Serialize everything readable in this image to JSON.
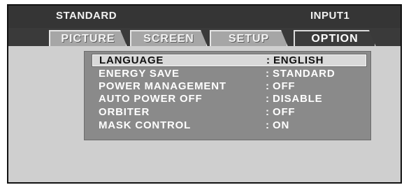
{
  "status": {
    "mode": "STANDARD",
    "input": "INPUT1"
  },
  "tabs": [
    {
      "label": "PICTURE",
      "active": false
    },
    {
      "label": "SCREEN",
      "active": false
    },
    {
      "label": "SETUP",
      "active": false
    },
    {
      "label": "OPTION",
      "active": true
    }
  ],
  "menu": {
    "separator": ":",
    "items": [
      {
        "label": "LANGUAGE",
        "value": "ENGLISH",
        "selected": true
      },
      {
        "label": "ENERGY SAVE",
        "value": "STANDARD",
        "selected": false
      },
      {
        "label": "POWER MANAGEMENT",
        "value": "OFF",
        "selected": false
      },
      {
        "label": "AUTO POWER OFF",
        "value": "DISABLE",
        "selected": false
      },
      {
        "label": "ORBITER",
        "value": "OFF",
        "selected": false
      },
      {
        "label": "MASK CONTROL",
        "value": "ON",
        "selected": false
      }
    ]
  },
  "colors": {
    "osd_frame": "#3a3a3a",
    "tab_inactive": "#a6a6a6",
    "tab_active": "#3c3c3c",
    "panel_bg": "#cfcfcf",
    "menu_bg": "#8a8a8a",
    "selection_bg": "#d9d9d9"
  }
}
